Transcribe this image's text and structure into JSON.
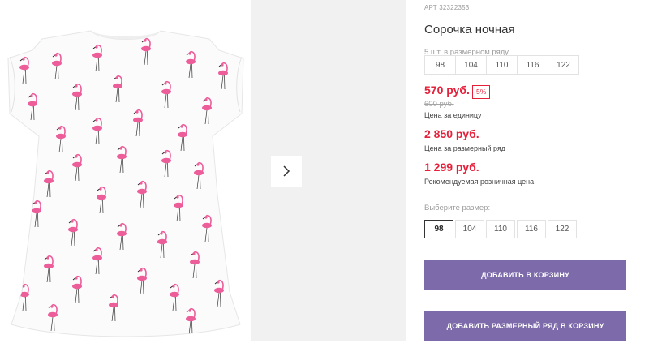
{
  "product": {
    "article": "АРТ 32322353",
    "title": "Сорочка ночная",
    "row_note": "5 шт. в размерном ряду",
    "row_sizes": [
      "98",
      "104",
      "110",
      "116",
      "122"
    ]
  },
  "pricing": {
    "unit_price": "570 руб.",
    "discount_badge": "5%",
    "old_price": "600 руб.",
    "unit_label": "Цена за единицу",
    "row_price": "2 850 руб.",
    "row_label": "Цена за размерный ряд",
    "rrp_price": "1 299 руб.",
    "rrp_label": "Рекомендуемая розничная цена"
  },
  "size_picker": {
    "label": "Выберите размер:",
    "options": [
      "98",
      "104",
      "110",
      "116",
      "122"
    ],
    "selected": "98"
  },
  "actions": {
    "add_to_cart": "ДОБАВИТЬ В КОРЗИНУ",
    "add_row_to_cart": "ДОБАВИТЬ РАЗМЕРНЫЙ РЯД В КОРЗИНУ"
  },
  "gallery": {
    "next_icon": "chevron-right-icon",
    "image": "white-dress-pink-flamingo-print"
  },
  "colors": {
    "accent_purple": "#7d6aaa",
    "price_red": "#e5203a",
    "flamingo_pink": "#ec5d9a"
  }
}
